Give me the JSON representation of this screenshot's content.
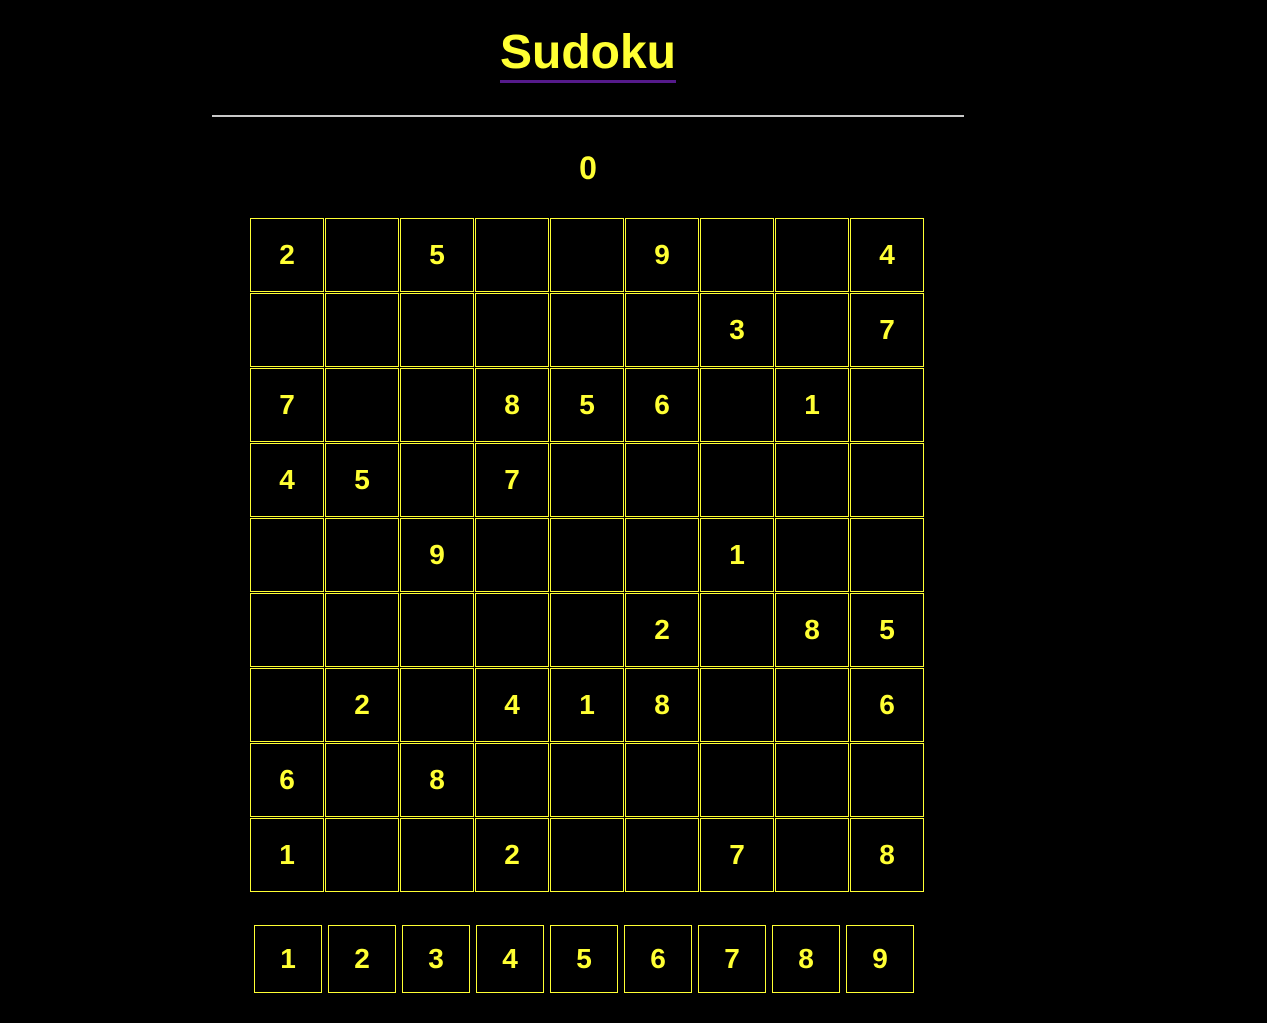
{
  "header": {
    "title": "Sudoku",
    "score": "0"
  },
  "board": {
    "rows": [
      [
        "2",
        "",
        "5",
        "",
        "",
        "9",
        "",
        "",
        "4"
      ],
      [
        "",
        "",
        "",
        "",
        "",
        "",
        "3",
        "",
        "7"
      ],
      [
        "7",
        "",
        "",
        "8",
        "5",
        "6",
        "",
        "1",
        ""
      ],
      [
        "4",
        "5",
        "",
        "7",
        "",
        "",
        "",
        "",
        ""
      ],
      [
        "",
        "",
        "9",
        "",
        "",
        "",
        "1",
        "",
        ""
      ],
      [
        "",
        "",
        "",
        "",
        "",
        "2",
        "",
        "8",
        "5"
      ],
      [
        "",
        "2",
        "",
        "4",
        "1",
        "8",
        "",
        "",
        "6"
      ],
      [
        "6",
        "",
        "8",
        "",
        "",
        "",
        "",
        "",
        ""
      ],
      [
        "1",
        "",
        "",
        "2",
        "",
        "",
        "7",
        "",
        "8"
      ]
    ]
  },
  "number_pad": {
    "buttons": [
      "1",
      "2",
      "3",
      "4",
      "5",
      "6",
      "7",
      "8",
      "9"
    ]
  },
  "colors": {
    "background": "#000000",
    "accent": "#ffff33",
    "divider": "#c8c8c8",
    "title_underline": "#551a8b"
  }
}
